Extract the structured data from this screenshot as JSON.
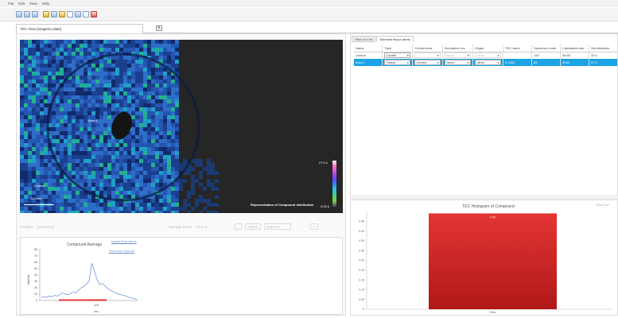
{
  "menu": [
    "File",
    "Edit",
    "View",
    "Help"
  ],
  "document_tab": {
    "title": "TEC View [Imagerie plate]",
    "close": "x"
  },
  "image_view": {
    "labels": {
      "area1": "Area 1",
      "control": "Control",
      "scale": "4.8 mm"
    },
    "legend_top": "27.0 k",
    "legend_caption": "Representation of Compound distribution",
    "legend_bottom": "0.00 k",
    "colors": [
      "#102a6a",
      "#1a3f8e",
      "#2456b0",
      "#2e6ec8",
      "#20a0c8",
      "#22b090",
      "#1a3a70"
    ]
  },
  "status_bar": {
    "position_label": "Position:",
    "position_value": "(1342;172)",
    "manage_zoom_label": "Manage Zoom:",
    "fit_label": "Fit to S",
    "zoom_in": "+",
    "zoom_out": "-",
    "zoom_value": "100%",
    "zoom_select": "Zoom %"
  },
  "compound_average": {
    "title": "Compound Average",
    "link1": "Update Peak Values",
    "link2": "Zoom Out / Show All",
    "ylabel": "Intensity",
    "xlabel": "m/z",
    "xtick": "478",
    "yticks": [
      "80",
      "70",
      "60",
      "50",
      "40",
      "30",
      "20",
      "10",
      "0"
    ]
  },
  "right_tabs": [
    "Filter m/z list",
    "Selected tissue areas"
  ],
  "table": {
    "headers": [
      "Name",
      "Type",
      "Control area",
      "Normalize m/z",
      "Organ",
      "TEC value",
      "Spectrum numb",
      "Calculated valu",
      "Std deviation"
    ],
    "rows": [
      {
        "name": "Control",
        "type": "Control",
        "control_area": "",
        "normalize": "None",
        "organ": "Other",
        "tec": "",
        "spectrum": "132",
        "calc": "46.65",
        "std": "33.4"
      },
      {
        "name": "Area 1",
        "type": "Tissue",
        "control_area": "Control",
        "normalize": "None",
        "organ": "Other",
        "tec": "0.4963",
        "spectrum": "89",
        "calc": "3160",
        "std": "57.5"
      }
    ]
  },
  "histogram": {
    "title": "TEC Histogram of Compound",
    "link": "Show Full",
    "bar_label": "0.49",
    "category": "Other"
  },
  "chart_data": [
    {
      "type": "line",
      "title": "Compound Average",
      "xlabel": "m/z",
      "ylabel": "Intensity",
      "xticks": [
        "478"
      ],
      "ylim": [
        0,
        80
      ],
      "yticks": [
        0,
        10,
        20,
        30,
        40,
        50,
        60,
        70,
        80
      ],
      "series": [
        {
          "values": [
            5,
            6,
            5,
            7,
            6,
            8,
            7,
            9,
            12,
            10,
            9,
            11,
            13,
            12,
            16,
            20,
            22,
            26,
            31,
            58,
            47,
            33,
            25,
            27,
            23,
            19,
            16,
            14,
            12,
            10,
            9,
            8,
            7,
            5,
            4,
            3,
            2
          ]
        }
      ]
    },
    {
      "type": "bar",
      "title": "TEC Histogram of Compound",
      "categories": [
        "Other"
      ],
      "values": [
        0.49
      ],
      "ylim": [
        0,
        0.5
      ],
      "yticks": [
        "0",
        "0.05",
        "0.10",
        "0.15",
        "0.20",
        "0.25",
        "0.30",
        "0.35",
        "0.40",
        "0.45"
      ],
      "color": "#e43535"
    }
  ]
}
